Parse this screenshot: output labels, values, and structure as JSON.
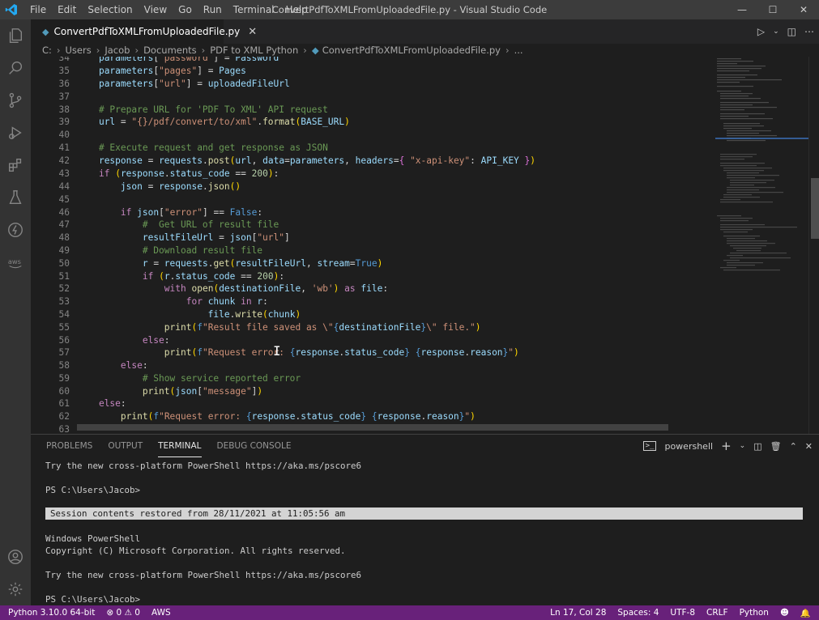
{
  "window": {
    "title": "ConvertPdfToXMLFromUploadedFile.py - Visual Studio Code",
    "menu": [
      "File",
      "Edit",
      "Selection",
      "View",
      "Go",
      "Run",
      "Terminal",
      "Help"
    ]
  },
  "tab": {
    "label": "ConvertPdfToXMLFromUploadedFile.py"
  },
  "breadcrumb": [
    "C:",
    "Users",
    "Jacob",
    "Documents",
    "PDF to XML Python",
    "ConvertPdfToXMLFromUploadedFile.py",
    "..."
  ],
  "editor": {
    "line_numbers": [
      "34",
      "35",
      "36",
      "37",
      "38",
      "39",
      "40",
      "41",
      "42",
      "43",
      "44",
      "45",
      "46",
      "47",
      "48",
      "49",
      "50",
      "51",
      "52",
      "53",
      "54",
      "55",
      "56",
      "57",
      "58",
      "59",
      "60",
      "61",
      "62",
      "63"
    ]
  },
  "panel": {
    "tabs": [
      "PROBLEMS",
      "OUTPUT",
      "TERMINAL",
      "DEBUG CONSOLE"
    ],
    "active_tab": "TERMINAL",
    "shell": "powershell",
    "terminal_lines": [
      "Try the new cross-platform PowerShell https://aka.ms/pscore6",
      "",
      "PS C:\\Users\\Jacob>",
      "",
      "Session contents restored from 28/11/2021 at 11:05:56 am",
      "",
      "Windows PowerShell",
      "Copyright (C) Microsoft Corporation. All rights reserved.",
      "",
      "Try the new cross-platform PowerShell https://aka.ms/pscore6",
      "",
      "PS C:\\Users\\Jacob>"
    ]
  },
  "statusbar": {
    "python": "Python 3.10.0 64-bit",
    "errors": "0",
    "warnings": "0",
    "aws": "AWS",
    "position": "Ln 17, Col 28",
    "spaces": "Spaces: 4",
    "encoding": "UTF-8",
    "eol": "CRLF",
    "language": "Python"
  },
  "colors": {
    "statusbar": "#68217a",
    "titlebar": "#3c3c3c",
    "activitybar": "#333333",
    "editor": "#1e1e1e"
  }
}
